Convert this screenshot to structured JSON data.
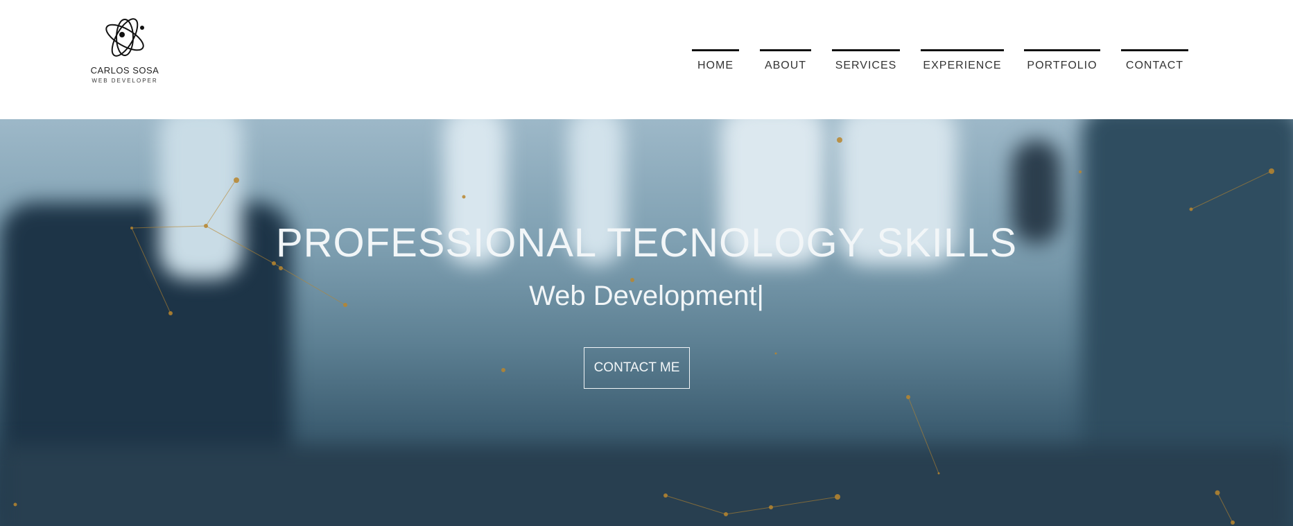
{
  "brand": {
    "name": "CARLOS SOSA",
    "tagline": "WEB DEVELOPER",
    "logo_icon": "atom-icon"
  },
  "nav": {
    "items": [
      {
        "label": "HOME"
      },
      {
        "label": "ABOUT"
      },
      {
        "label": "SERVICES"
      },
      {
        "label": "EXPERIENCE"
      },
      {
        "label": "PORTFOLIO"
      },
      {
        "label": "CONTACT"
      }
    ]
  },
  "hero": {
    "title": "PROFESSIONAL TECNOLOGY SKILLS",
    "subtitle": "Web Development|",
    "cta_label": "CONTACT ME"
  },
  "colors": {
    "nav_border": "#111111",
    "hero_text": "#f2f6f8",
    "network_dots": "#b8862e"
  }
}
